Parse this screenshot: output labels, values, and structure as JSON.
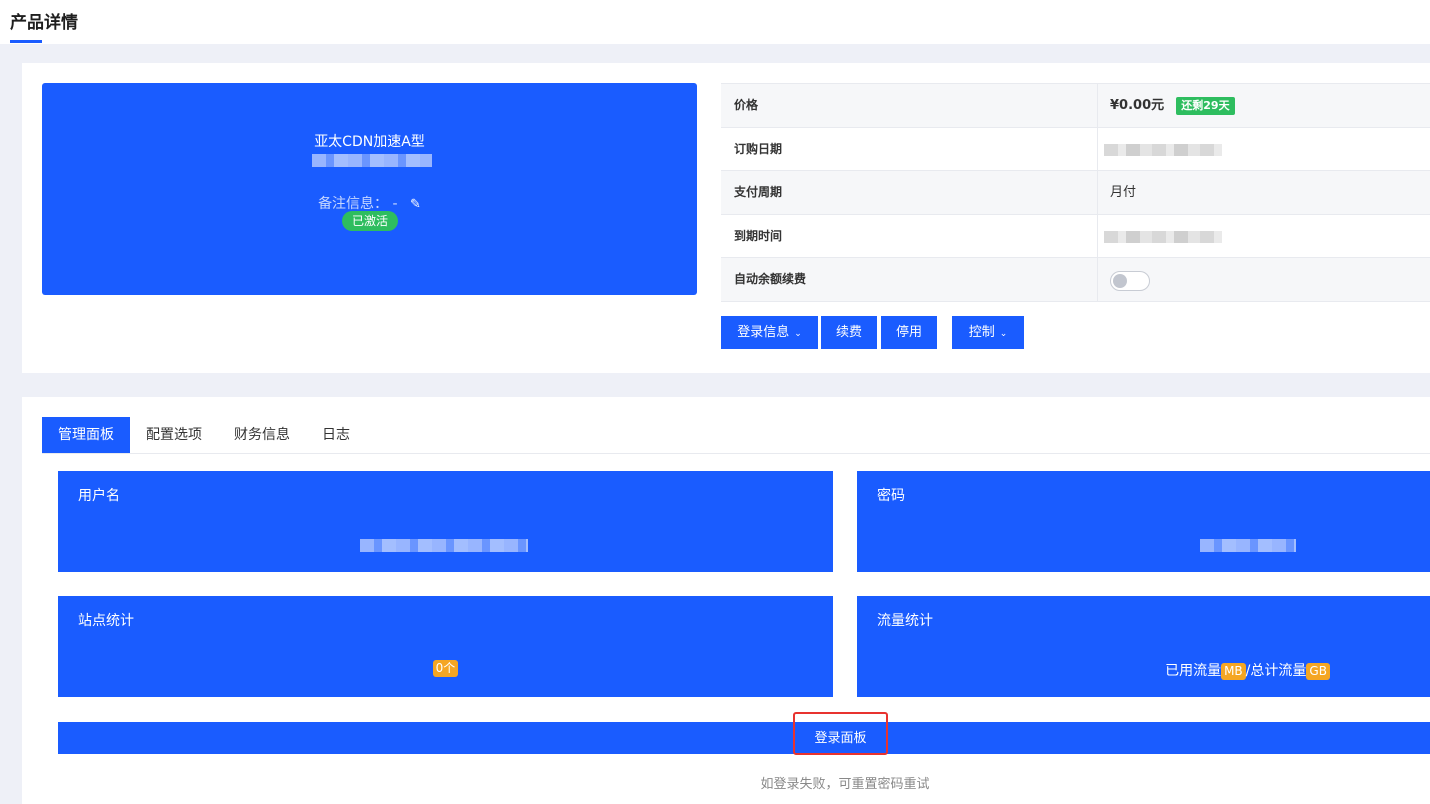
{
  "page": {
    "title": "产品详情"
  },
  "product": {
    "name": "亚太CDN加速A型",
    "remark_label": "备注信息：",
    "remark_value": "-",
    "status": "已激活",
    "edit_icon": "pencil-icon"
  },
  "info": {
    "rows": [
      {
        "key": "价格",
        "value": "¥0.00元",
        "badge": "还剩29天"
      },
      {
        "key": "订购日期",
        "value": ""
      },
      {
        "key": "支付周期",
        "value": "月付"
      },
      {
        "key": "到期时间",
        "value": ""
      },
      {
        "key": "自动余额续费",
        "value": ""
      }
    ],
    "auto_renew": false
  },
  "actions": {
    "login_info": "登录信息",
    "renew": "续费",
    "disable": "停用",
    "control": "控制",
    "chevron_icon": "chevron-down-icon"
  },
  "tabs": [
    {
      "label": "管理面板",
      "active": true
    },
    {
      "label": "配置选项",
      "active": false
    },
    {
      "label": "财务信息",
      "active": false
    },
    {
      "label": "日志",
      "active": false
    }
  ],
  "panels": {
    "username": {
      "title": "用户名"
    },
    "password": {
      "title": "密码"
    },
    "sites": {
      "title": "站点统计",
      "count": "0个"
    },
    "traffic": {
      "title": "流量统计",
      "used_label": "已用流量",
      "used_unit": "MB",
      "sep": "/总计流量",
      "total_unit": "GB"
    }
  },
  "login_panel_button": "登录面板",
  "hint": "如登录失败，可重置密码重试",
  "colors": {
    "primary": "#1a5cff",
    "success": "#2ebd5f",
    "warning": "#f5a623",
    "highlight": "#e8332f"
  }
}
